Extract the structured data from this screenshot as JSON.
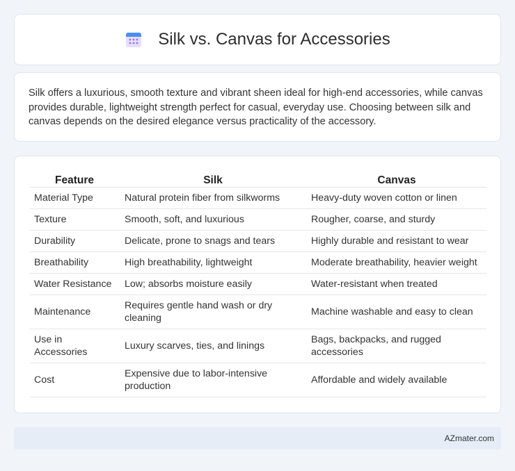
{
  "header": {
    "title": "Silk vs. Canvas for Accessories",
    "icon": "calendar-icon"
  },
  "intro": {
    "text": "Silk offers a luxurious, smooth texture and vibrant sheen ideal for high-end accessories, while canvas provides durable, lightweight strength perfect for casual, everyday use. Choosing between silk and canvas depends on the desired elegance versus practicality of the accessory."
  },
  "table": {
    "headers": [
      "Feature",
      "Silk",
      "Canvas"
    ],
    "rows": [
      [
        "Material Type",
        "Natural protein fiber from silkworms",
        "Heavy-duty woven cotton or linen"
      ],
      [
        "Texture",
        "Smooth, soft, and luxurious",
        "Rougher, coarse, and sturdy"
      ],
      [
        "Durability",
        "Delicate, prone to snags and tears",
        "Highly durable and resistant to wear"
      ],
      [
        "Breathability",
        "High breathability, lightweight",
        "Moderate breathability, heavier weight"
      ],
      [
        "Water Resistance",
        "Low; absorbs moisture easily",
        "Water-resistant when treated"
      ],
      [
        "Maintenance",
        "Requires gentle hand wash or dry cleaning",
        "Machine washable and easy to clean"
      ],
      [
        "Use in Accessories",
        "Luxury scarves, ties, and linings",
        "Bags, backpacks, and rugged accessories"
      ],
      [
        "Cost",
        "Expensive due to labor-intensive production",
        "Affordable and widely available"
      ]
    ]
  },
  "footer": {
    "brand": "AZmater.com"
  },
  "colors": {
    "page_bg": "#f1f4f9",
    "card_bg": "#ffffff",
    "footer_bg": "#e6edf7",
    "icon_blue": "#4a8ff0",
    "icon_purple": "#8e7ad8"
  }
}
